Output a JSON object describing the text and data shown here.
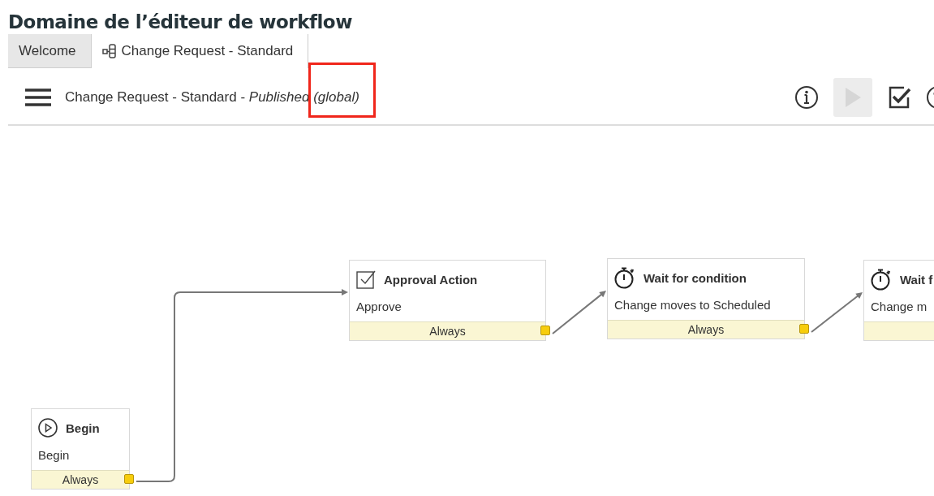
{
  "page_title": "Domaine de l’éditeur de workflow",
  "tabs": [
    {
      "label": "Welcome",
      "selected": false,
      "icon": false
    },
    {
      "label": "Change Request - Standard",
      "selected": true,
      "icon": true
    }
  ],
  "toolbar": {
    "heading": "Change Request - Standard - *Published (global)*",
    "run_disabled": true
  },
  "nodes": [
    {
      "kind": "begin",
      "title": "Begin",
      "description": "Begin",
      "condition": "Always"
    },
    {
      "kind": "approval",
      "title": "Approval Action",
      "description": "Approve",
      "condition": "Always"
    },
    {
      "kind": "timer",
      "title": "Wait for condition",
      "description": "Change moves to Scheduled",
      "condition": "Always"
    },
    {
      "kind": "timer",
      "title": "Wait f",
      "description": "Change m"
    }
  ]
}
